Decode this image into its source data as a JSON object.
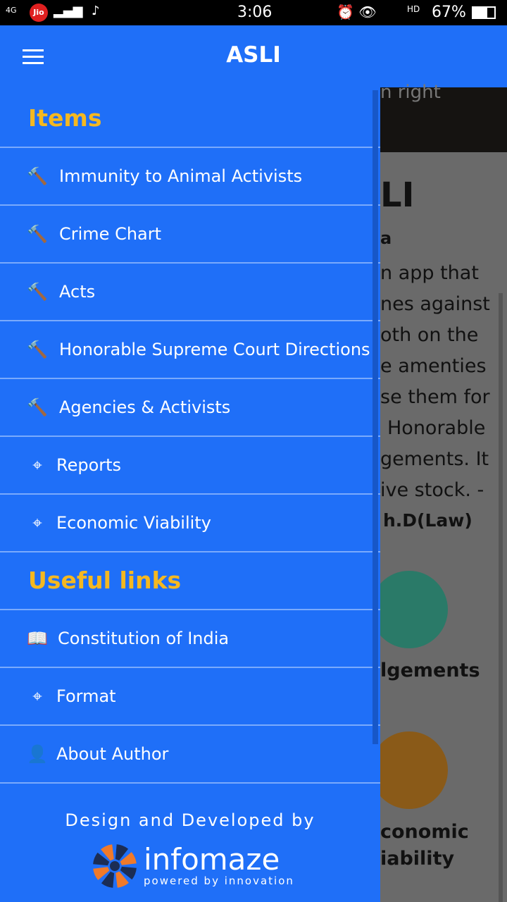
{
  "status": {
    "network": "4G",
    "carrier": "Jio",
    "time": "3:06",
    "battery": "67%",
    "hd": "HD"
  },
  "appbar": {
    "title": "ASLI"
  },
  "background": {
    "banner_text": "n right",
    "heading": "LI",
    "subheading": "a",
    "paragraph": [
      "n app that",
      "nes against",
      "oth on the",
      "e amenties",
      "se them for",
      "Honorable",
      "gements. It",
      "ive stock. -"
    ],
    "author": "h.D(Law)",
    "card1": "lgements",
    "card2_line1": "conomic",
    "card2_line2": "iability"
  },
  "drawer": {
    "items_header": "Items",
    "items": [
      {
        "label": "Immunity to Animal Activists",
        "icon": "gavel-icon"
      },
      {
        "label": "Crime Chart",
        "icon": "gavel-icon"
      },
      {
        "label": "Acts",
        "icon": "gavel-icon"
      },
      {
        "label": "Honorable Supreme Court Directions",
        "icon": "gavel-icon"
      },
      {
        "label": "Agencies & Activists",
        "icon": "gavel-icon"
      },
      {
        "label": "Reports",
        "icon": "crosshairs-icon"
      },
      {
        "label": "Economic Viability",
        "icon": "crosshairs-icon"
      }
    ],
    "links_header": "Useful links",
    "links": [
      {
        "label": "Constitution of India",
        "icon": "book-icon"
      },
      {
        "label": "Format",
        "icon": "crosshairs-icon"
      },
      {
        "label": "About Author",
        "icon": "user-icon"
      }
    ],
    "footer_text": "Design and Developed by",
    "brand_name": "infomaze",
    "brand_tagline": "powered by innovation"
  },
  "colors": {
    "primary": "#1f6ff8",
    "accent": "#f5b820"
  }
}
